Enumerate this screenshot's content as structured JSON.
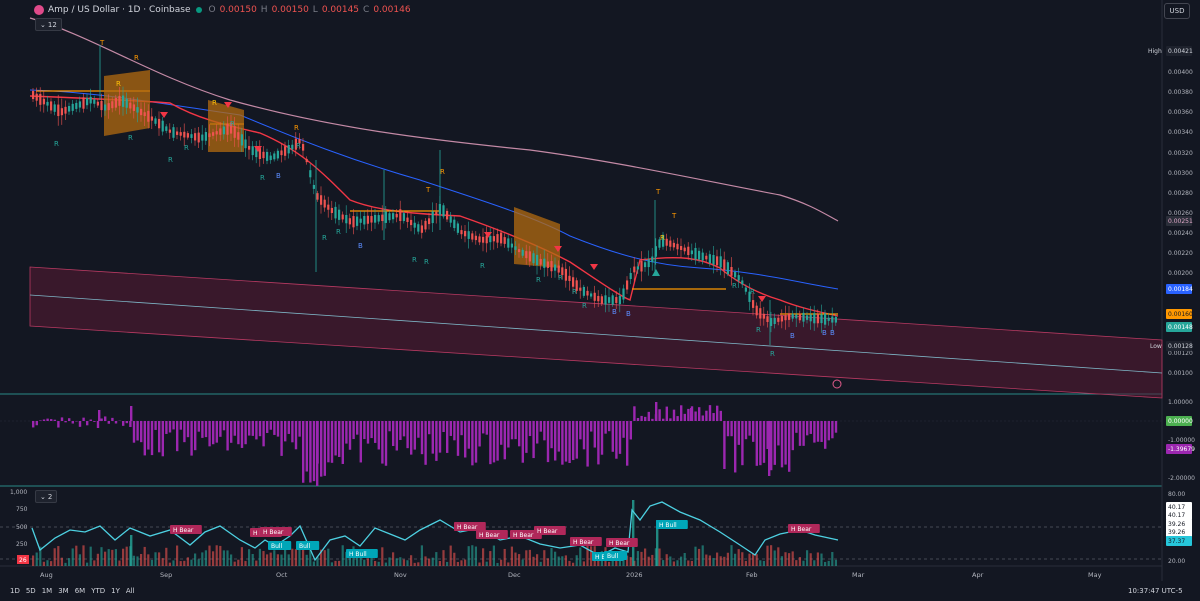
{
  "header": {
    "symbol": "Amp / US Dollar · 1D · Coinbase",
    "o_label": "O",
    "o_value": "0.00150",
    "h_label": "H",
    "h_value": "0.00150",
    "l_label": "L",
    "l_value": "0.00145",
    "c_label": "C",
    "c_value": "0.00146"
  },
  "currency": "USD",
  "indicator_badge_top": "12",
  "indicator_badge_bottom": "2",
  "price_axis": {
    "ticks": [
      "0.00400",
      "0.00380",
      "0.00360",
      "0.00340",
      "0.00320",
      "0.00300",
      "0.00280",
      "0.00260",
      "0.00240",
      "0.00220",
      "0.00200",
      "0.00120",
      "0.00100"
    ],
    "high_label": "High",
    "high_value": "0.00421",
    "low_label": "Low",
    "low_value": "0.00128",
    "tags": [
      {
        "text": "0.00251",
        "color": "#2a2e39",
        "fg": "#e0a8c8"
      },
      {
        "text": "0.00184",
        "color": "#2962ff",
        "fg": "#ffffff"
      },
      {
        "text": "0.00160",
        "color": "#ff9800",
        "fg": "#131722"
      },
      {
        "text": "0.00148",
        "color": "#26a69a",
        "fg": "#ffffff"
      }
    ]
  },
  "osc_axis": {
    "ticks": [
      "1.00000",
      "-1.00000",
      "-2.00000"
    ],
    "tags": [
      {
        "text": "0.00000",
        "color": "#4caf50",
        "fg": "#ffffff"
      },
      {
        "text": "-1.39679",
        "color": "#9c27b0",
        "fg": "#ffffff"
      }
    ]
  },
  "vol_axis": {
    "left_ticks": [
      "1,000",
      "750",
      "500",
      "250"
    ],
    "right_ticks": [
      "80.00",
      "20.00"
    ],
    "tags": [
      {
        "text": "40.17",
        "color": "#ffffff",
        "fg": "#131722"
      },
      {
        "text": "40.17",
        "color": "#ffffff",
        "fg": "#131722"
      },
      {
        "text": "39.26",
        "color": "#ffffff",
        "fg": "#131722"
      },
      {
        "text": "39.26",
        "color": "#ffffff",
        "fg": "#131722"
      },
      {
        "text": "37.37",
        "color": "#26c6da",
        "fg": "#131722"
      }
    ],
    "left_tag": "26"
  },
  "time_axis": [
    "Aug",
    "Sep",
    "Oct",
    "Nov",
    "Dec",
    "2026",
    "Jan",
    "Feb",
    "Mar",
    "Apr",
    "May"
  ],
  "signals": {
    "h_bear": "H Bear",
    "h_bull": "H Bull",
    "bull": "Bull"
  },
  "timeframes": [
    "1D",
    "5D",
    "1M",
    "3M",
    "6M",
    "YTD",
    "1Y",
    "All"
  ],
  "clock": "10:37:47 UTC-5",
  "colors": {
    "bg": "#131722",
    "up": "#26a69a",
    "down": "#ef5350",
    "ema_red": "#f23645",
    "ema_blue": "#2962ff",
    "ma_pink": "#c48aa6",
    "osc": "#9c27b0",
    "rsi": "#4dd0e1"
  }
}
